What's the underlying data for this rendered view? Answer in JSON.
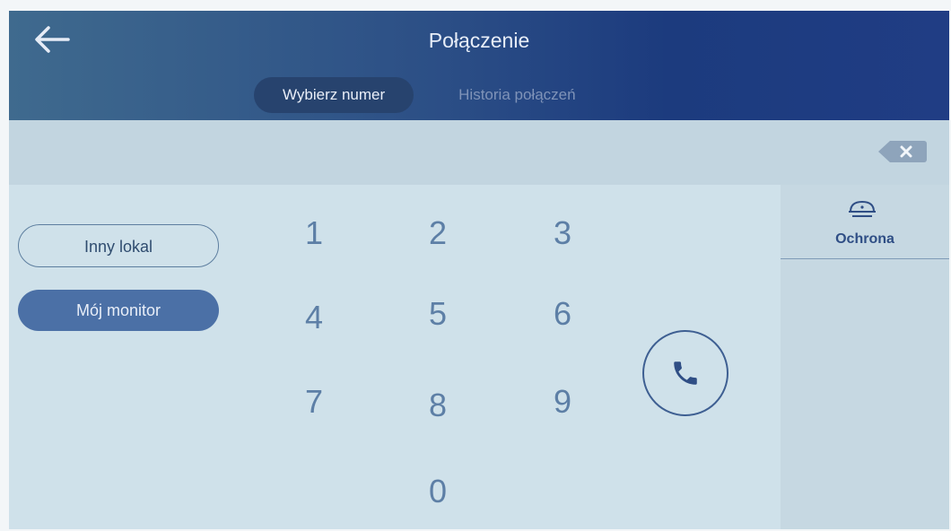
{
  "header": {
    "title": "Połączenie",
    "tabs": [
      {
        "label": "Wybierz numer",
        "active": true
      },
      {
        "label": "Historia połączeń",
        "active": false
      }
    ]
  },
  "icons": {
    "back": "arrow-left-icon",
    "delete": "backspace-icon",
    "call": "phone-icon",
    "security": "alarm-icon"
  },
  "left_panel": {
    "buttons": [
      "Inny lokal",
      "Mój monitor"
    ]
  },
  "keypad": {
    "keys": [
      "1",
      "2",
      "3",
      "4",
      "5",
      "6",
      "7",
      "8",
      "9",
      "0"
    ]
  },
  "right_panel": {
    "tabs": [
      {
        "label": "Ochrona"
      }
    ]
  },
  "colors": {
    "header_start": "#3f6a8e",
    "header_end": "#1c3b7e",
    "accent": "#4b70a6",
    "key_text": "#5d7fa6"
  }
}
